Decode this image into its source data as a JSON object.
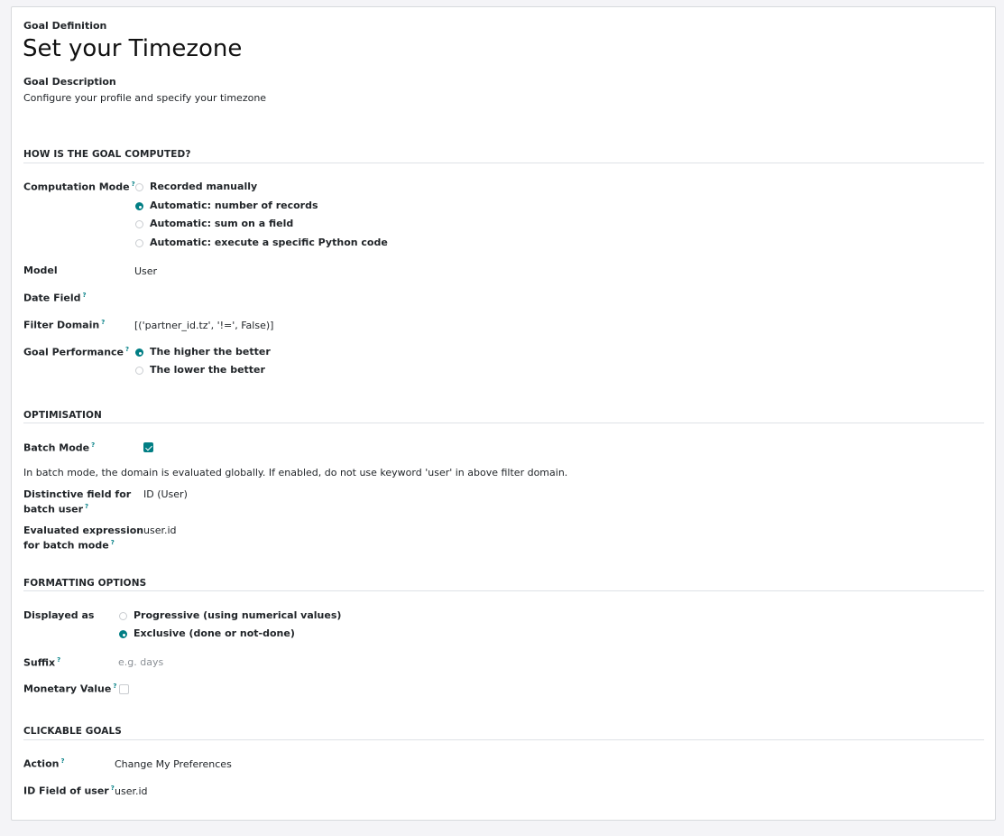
{
  "header": {
    "definition_label": "Goal Definition",
    "title": "Set your Timezone",
    "description_label": "Goal Description",
    "description": "Configure your profile and specify your timezone"
  },
  "computed": {
    "section_title": "HOW IS THE GOAL COMPUTED?",
    "mode_label": "Computation Mode",
    "mode_options": [
      {
        "label": "Recorded manually",
        "selected": false
      },
      {
        "label": "Automatic: number of records",
        "selected": true
      },
      {
        "label": "Automatic: sum on a field",
        "selected": false
      },
      {
        "label": "Automatic: execute a specific Python code",
        "selected": false
      }
    ],
    "model_label": "Model",
    "model_value": "User",
    "date_field_label": "Date Field",
    "filter_label": "Filter Domain",
    "filter_value": "[('partner_id.tz', '!=', False)]",
    "performance_label": "Goal Performance",
    "performance_options": [
      {
        "label": "The higher the better",
        "selected": true
      },
      {
        "label": "The lower the better",
        "selected": false
      }
    ]
  },
  "optimisation": {
    "section_title": "OPTIMISATION",
    "batch_label": "Batch Mode",
    "batch_checked": true,
    "batch_note": "In batch mode, the domain is evaluated globally. If enabled, do not use keyword 'user' in above filter domain.",
    "distinctive_label_1": "Distinctive field for",
    "distinctive_label_2": "batch user",
    "distinctive_value": "ID (User)",
    "evaluated_label_1": "Evaluated expression",
    "evaluated_label_2": "for batch mode",
    "evaluated_value": "user.id"
  },
  "formatting": {
    "section_title": "FORMATTING OPTIONS",
    "displayed_label": "Displayed as",
    "displayed_options": [
      {
        "label": "Progressive (using numerical values)",
        "selected": false
      },
      {
        "label": "Exclusive (done or not-done)",
        "selected": true
      }
    ],
    "suffix_label": "Suffix",
    "suffix_placeholder": "e.g. days",
    "monetary_label": "Monetary Value",
    "monetary_checked": false
  },
  "clickable": {
    "section_title": "CLICKABLE GOALS",
    "action_label": "Action",
    "action_value": "Change My Preferences",
    "id_field_label": "ID Field of user",
    "id_field_value": "user.id"
  },
  "help_marker": "?",
  "accent_color": "#017e84"
}
